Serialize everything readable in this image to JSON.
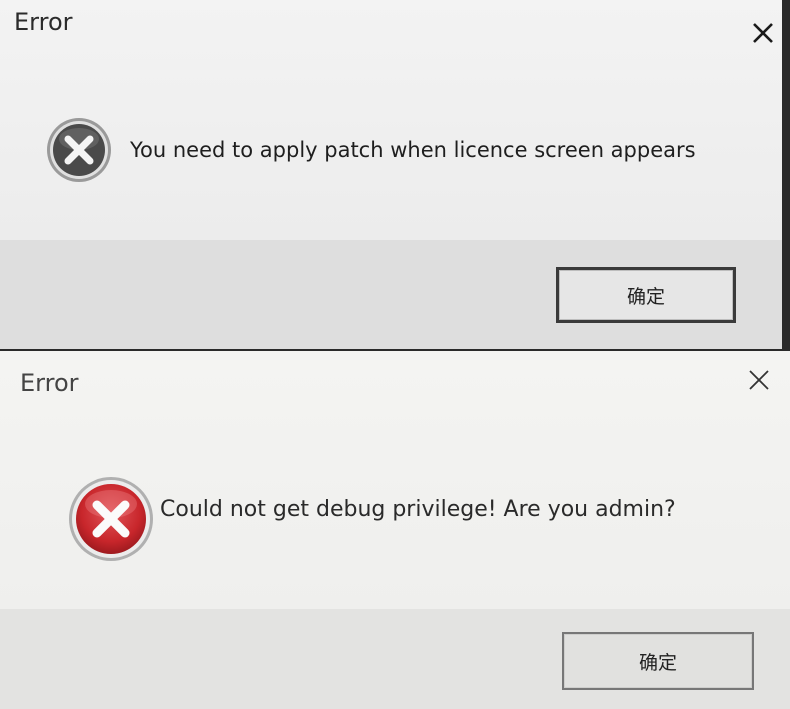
{
  "dialogs": [
    {
      "title": "Error",
      "message": "You need to apply patch when licence screen appears",
      "ok_label": "确定",
      "icon": "error-icon",
      "colors": {
        "icon_fill": "#4a4a4a",
        "icon_ring": "#9a9a9a"
      }
    },
    {
      "title": "Error",
      "message": "Could not get debug privilege! Are you admin?",
      "ok_label": "确定",
      "icon": "error-icon",
      "colors": {
        "icon_fill": "#c8262b",
        "icon_ring": "#b0b0b0"
      }
    }
  ]
}
